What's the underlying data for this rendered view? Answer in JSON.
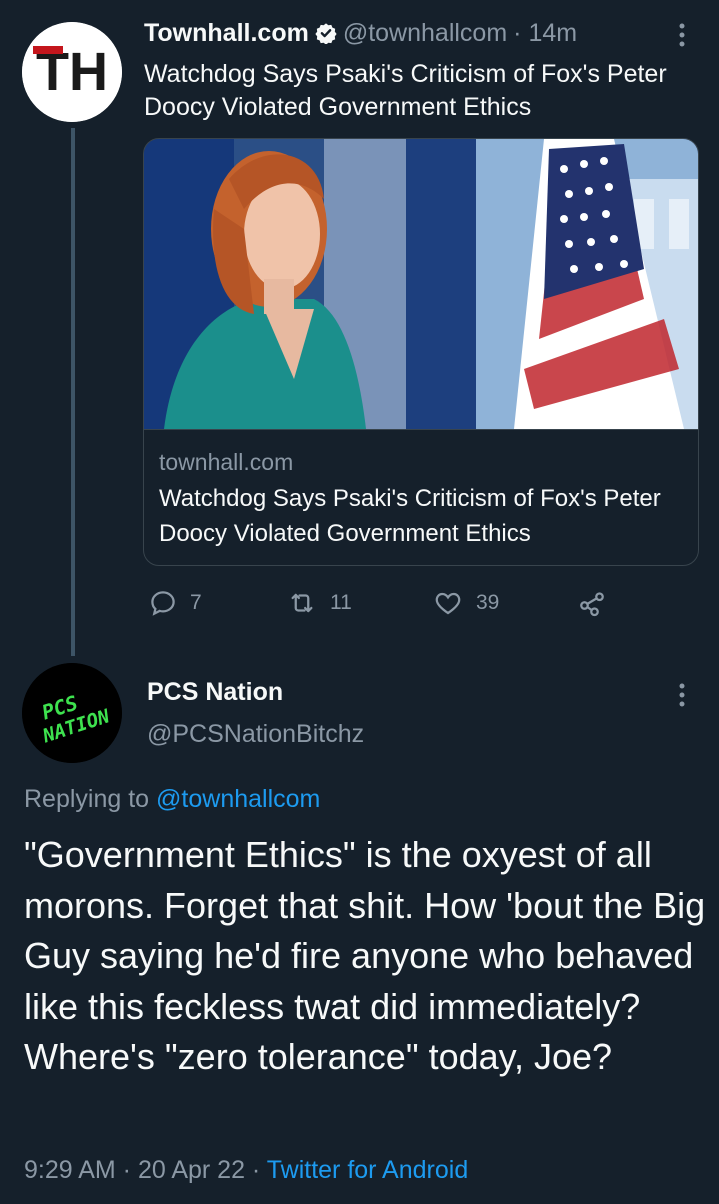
{
  "tweet": {
    "author_avatar": "TH",
    "author_name": "Townhall.com",
    "author_handle": "@townhallcom",
    "time": "· 14m",
    "text": "Watchdog Says Psaki's Criticism of Fox's Peter Doocy Violated Government Ethics",
    "card": {
      "domain": "townhall.com",
      "title": "Watchdog Says Psaki's Criticism of Fox's Peter Doocy Violated Government Ethics"
    },
    "actions": {
      "reply_count": "7",
      "retweet_count": "11",
      "like_count": "39"
    }
  },
  "reply": {
    "author_name": "PCS Nation",
    "author_handle": "@PCSNationBitchz",
    "avatar_text_line1": "PCS",
    "avatar_text_line2": "NATION",
    "replying_label": "Replying to",
    "replying_handle": "@townhallcom",
    "text": "\"Government Ethics\" is the oxyest of all morons. Forget that shit. How 'bout the Big Guy saying he'd fire anyone who behaved like this feckless twat did immediately? Where's \"zero tolerance\" today, Joe?",
    "timestamp": "9:29 AM · 20 Apr 22 ·",
    "source": "Twitter for Android"
  },
  "colors": {
    "background": "#15202b",
    "text": "#f7f9f9",
    "muted": "#8b98a5",
    "accent": "#1d9bf0",
    "verified": "#1d9bf0",
    "pcs_green": "#3ee24f"
  },
  "icons": [
    "verified-badge-icon",
    "more-icon",
    "reply-icon",
    "retweet-icon",
    "like-icon",
    "share-icon"
  ]
}
